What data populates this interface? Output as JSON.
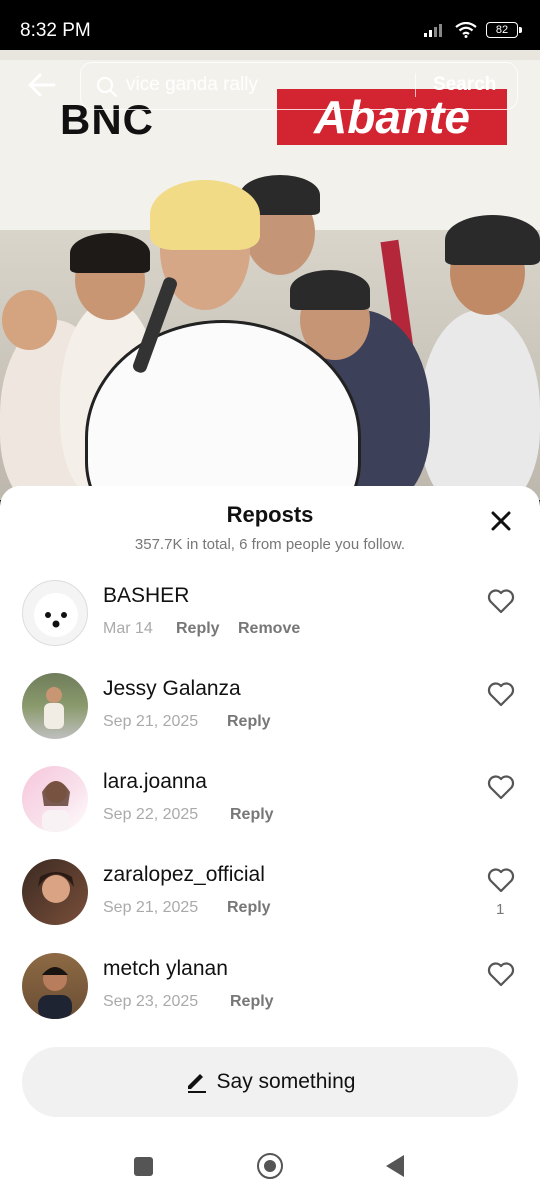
{
  "status": {
    "time": "8:32 PM",
    "battery": "82"
  },
  "search": {
    "query": "vice ganda rally",
    "button": "Search"
  },
  "video": {
    "logo_left": "BNC",
    "logo_right": "Abante"
  },
  "sheet": {
    "title": "Reposts",
    "subtitle": "357.7K in total, 6 from people you follow.",
    "items": [
      {
        "name": "BASHER",
        "date": "Mar 14",
        "reply": "Reply",
        "remove": "Remove",
        "likes": ""
      },
      {
        "name": "Jessy Galanza",
        "date": "Sep 21, 2025",
        "reply": "Reply",
        "likes": ""
      },
      {
        "name": "lara.joanna",
        "date": "Sep 22, 2025",
        "reply": "Reply",
        "likes": ""
      },
      {
        "name": "zaralopez_official",
        "date": "Sep 21, 2025",
        "reply": "Reply",
        "likes": "1"
      },
      {
        "name": "metch ylanan",
        "date": "Sep 23, 2025",
        "reply": "Reply",
        "likes": ""
      }
    ],
    "compose_label": "Say something"
  },
  "colors": {
    "accent_red": "#d32531",
    "sheet_bg": "#ffffff",
    "muted": "#777777"
  }
}
